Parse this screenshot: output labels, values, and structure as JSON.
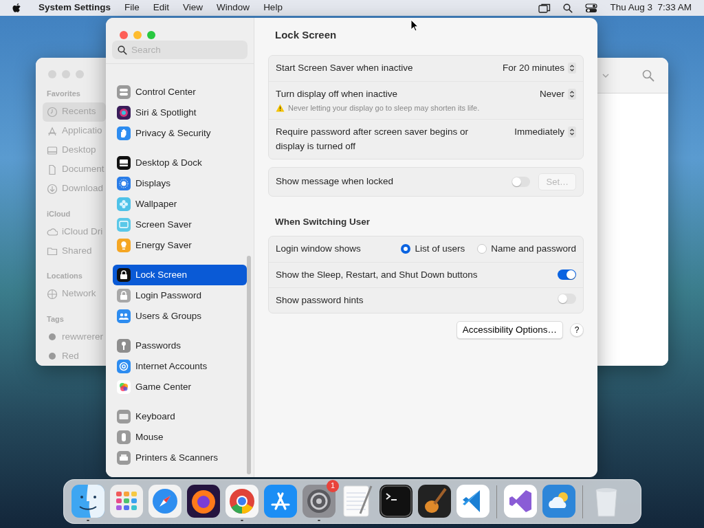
{
  "menubar": {
    "app": "System Settings",
    "menus": [
      "File",
      "Edit",
      "View",
      "Window",
      "Help"
    ],
    "clock": "Thu Aug 3  7:33 AM"
  },
  "finder": {
    "sections": [
      {
        "title": "Favorites",
        "items": [
          {
            "label": "Recents",
            "selected": true
          },
          {
            "label": "Applicatio",
            "selected": false
          },
          {
            "label": "Desktop",
            "selected": false
          },
          {
            "label": "Document",
            "selected": false
          },
          {
            "label": "Download",
            "selected": false
          }
        ]
      },
      {
        "title": "iCloud",
        "items": [
          {
            "label": "iCloud Dri",
            "selected": false
          },
          {
            "label": "Shared",
            "selected": false
          }
        ]
      },
      {
        "title": "Locations",
        "items": [
          {
            "label": "Network",
            "selected": false
          }
        ]
      },
      {
        "title": "Tags",
        "items": [
          {
            "label": "rewwrerer",
            "selected": false
          },
          {
            "label": "Red",
            "selected": false
          }
        ]
      }
    ]
  },
  "settings": {
    "search": {
      "placeholder": "Search"
    },
    "sidebar": [
      [
        {
          "label": "Control Center",
          "selected": false
        },
        {
          "label": "Siri & Spotlight",
          "selected": false
        },
        {
          "label": "Privacy & Security",
          "selected": false
        }
      ],
      [
        {
          "label": "Desktop & Dock",
          "selected": false
        },
        {
          "label": "Displays",
          "selected": false
        },
        {
          "label": "Wallpaper",
          "selected": false
        },
        {
          "label": "Screen Saver",
          "selected": false
        },
        {
          "label": "Energy Saver",
          "selected": false
        }
      ],
      [
        {
          "label": "Lock Screen",
          "selected": true
        },
        {
          "label": "Login Password",
          "selected": false
        },
        {
          "label": "Users & Groups",
          "selected": false
        }
      ],
      [
        {
          "label": "Passwords",
          "selected": false
        },
        {
          "label": "Internet Accounts",
          "selected": false
        },
        {
          "label": "Game Center",
          "selected": false
        }
      ],
      [
        {
          "label": "Keyboard",
          "selected": false
        },
        {
          "label": "Mouse",
          "selected": false
        },
        {
          "label": "Printers & Scanners",
          "selected": false
        }
      ]
    ],
    "title": "Lock Screen",
    "sections": [
      {
        "rows": [
          {
            "kind": "popup",
            "label": "Start Screen Saver when inactive",
            "value": "For 20 minutes"
          },
          {
            "kind": "popup",
            "label": "Turn display off when inactive",
            "value": "Never",
            "warning": "Never letting your display go to sleep may shorten its life."
          },
          {
            "kind": "popup",
            "label": "Require password after screen saver begins or display is turned off",
            "value": "Immediately"
          }
        ]
      },
      {
        "rows": [
          {
            "kind": "toggle",
            "label": "Show message when locked",
            "on": false,
            "button": {
              "label": "Set…",
              "disabled": true
            }
          }
        ]
      },
      {
        "heading": "When Switching User",
        "rows": [
          {
            "kind": "radio",
            "label": "Login window shows",
            "options": [
              {
                "label": "List of users",
                "selected": true
              },
              {
                "label": "Name and password",
                "selected": false
              }
            ]
          },
          {
            "kind": "toggle",
            "label": "Show the Sleep, Restart, and Shut Down buttons",
            "on": true
          },
          {
            "kind": "toggle",
            "label": "Show password hints",
            "on": false
          }
        ]
      }
    ],
    "footer": {
      "button": "Accessibility Options…",
      "help": "?"
    }
  },
  "dock": [
    [
      {
        "running": true
      },
      {
        "running": false
      },
      {
        "running": false
      },
      {
        "running": false
      },
      {
        "running": true
      },
      {
        "running": false
      },
      {
        "running": true,
        "badge": "1"
      },
      {
        "running": false
      },
      {
        "running": false
      },
      {
        "running": false
      },
      {
        "running": false
      }
    ],
    [
      {
        "running": false
      },
      {
        "running": false
      }
    ],
    [
      {
        "running": false
      }
    ]
  ]
}
